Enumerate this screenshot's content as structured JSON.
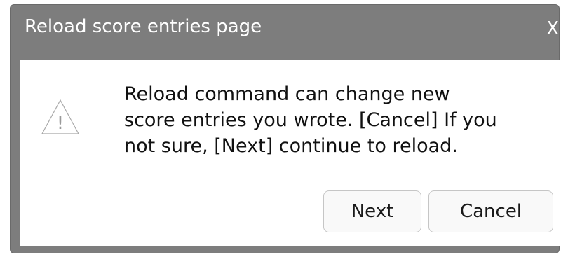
{
  "dialog": {
    "title": "Reload score entries page",
    "close_label": "X",
    "message_lines": [
      "Reload command can change new",
      "score entries you wrote. [Cancel] If you",
      "not sure, [Next] continue to reload."
    ],
    "icon": "warning-triangle-icon",
    "icon_glyph": "!",
    "next_label": "Next",
    "cancel_label": "Cancel"
  },
  "colors": {
    "titlebar": "#7d7d7d",
    "content_bg": "#ffffff",
    "title_text": "#ffffff",
    "button_bg": "#f9f9f9",
    "button_border": "#c6c6c6"
  }
}
